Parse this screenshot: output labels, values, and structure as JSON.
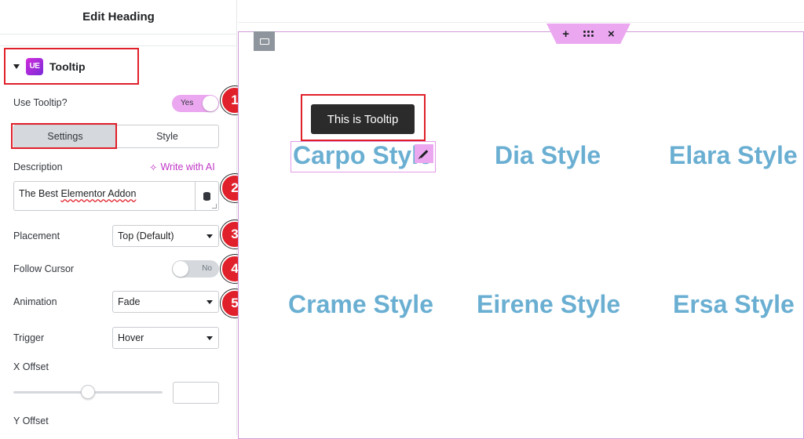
{
  "panel": {
    "title": "Edit Heading",
    "section": {
      "label": "Tooltip",
      "icon": "widget-icon",
      "icon_text": "UE"
    },
    "use_tooltip": {
      "label": "Use Tooltip?",
      "state": "Yes"
    },
    "tabs": [
      {
        "label": "Settings",
        "active": true
      },
      {
        "label": "Style",
        "active": false
      }
    ],
    "description": {
      "label": "Description",
      "ai_link": "Write with AI",
      "value_prefix": "The Best ",
      "value_misspelled": "Elementor Addon"
    },
    "placement": {
      "label": "Placement",
      "value": "Top (Default)"
    },
    "follow_cursor": {
      "label": "Follow Cursor",
      "state": "No"
    },
    "animation": {
      "label": "Animation",
      "value": "Fade"
    },
    "trigger": {
      "label": "Trigger",
      "value": "Hover"
    },
    "x_offset": {
      "label": "X Offset",
      "slider_fraction": 0.5,
      "value": ""
    },
    "y_offset": {
      "label": "Y Offset"
    }
  },
  "badges": [
    "1",
    "2",
    "3",
    "4",
    "5"
  ],
  "canvas": {
    "toolbar": {
      "add": "+",
      "close": "×"
    },
    "tooltip_text": "This is Tooltip",
    "headings": [
      "Carpo Style",
      "Dia Style",
      "Elara Style",
      "Crame Style",
      "Eirene Style",
      "Ersa Style"
    ]
  },
  "colors": {
    "accent_pink": "#eba8f0",
    "annotation_red": "#e0202a",
    "heading_blue": "#6aafd2",
    "tooltip_bg": "#2b2b2b"
  }
}
